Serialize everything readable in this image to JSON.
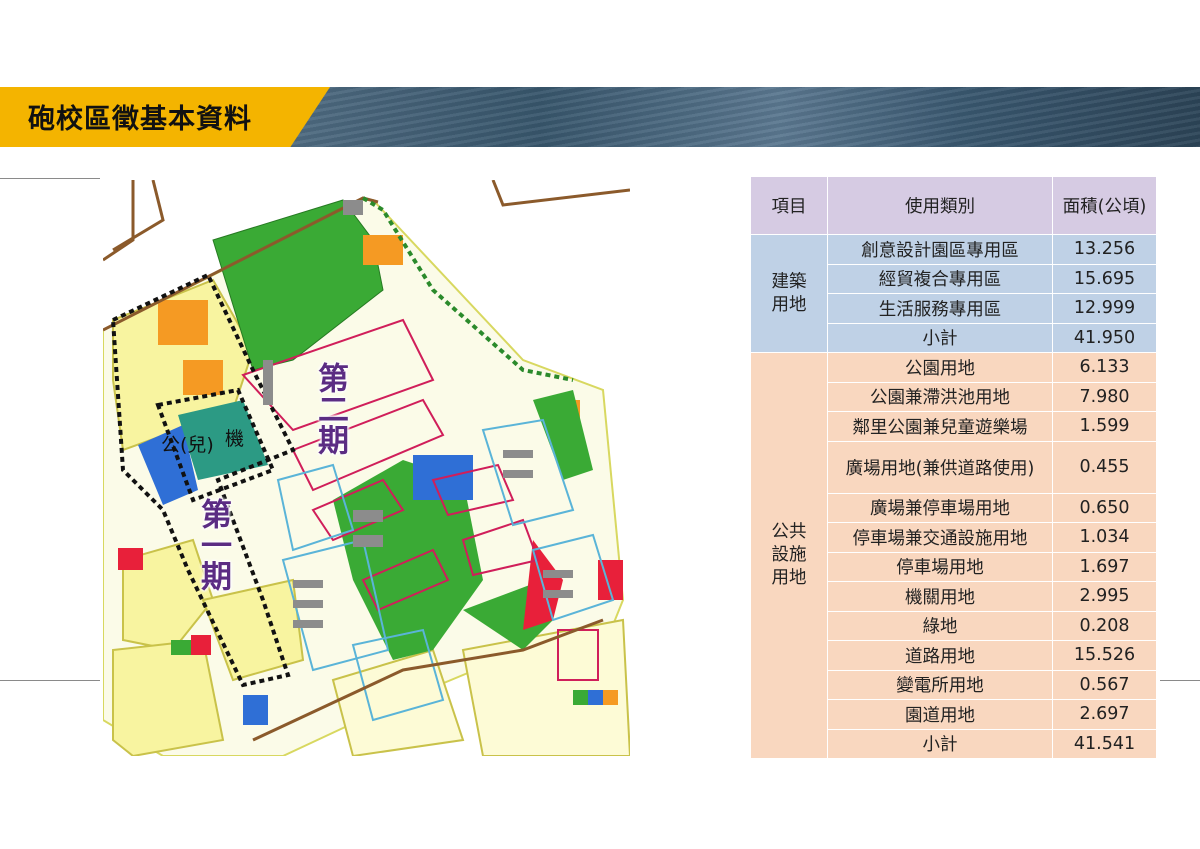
{
  "header": {
    "title": "砲校區徵基本資料"
  },
  "map": {
    "phase1_label": "第一期",
    "phase2_label": "第二期",
    "park_label": "公(兒)",
    "agency_label": "機"
  },
  "table": {
    "headers": [
      "項目",
      "使用類別",
      "面積(公頃)"
    ],
    "groups": [
      {
        "category": "建築用地",
        "rows": [
          {
            "type": "創意設計園區專用區",
            "area": "13.256"
          },
          {
            "type": "經貿複合專用區",
            "area": "15.695"
          },
          {
            "type": "生活服務專用區",
            "area": "12.999"
          },
          {
            "type": "小計",
            "area": "41.950"
          }
        ]
      },
      {
        "category": "公共設施用地",
        "rows": [
          {
            "type": "公園用地",
            "area": "6.133"
          },
          {
            "type": "公園兼滯洪池用地",
            "area": "7.980"
          },
          {
            "type": "鄰里公園兼兒童遊樂場",
            "area": "1.599"
          },
          {
            "type": "廣場用地(兼供道路使用)",
            "area": "0.455"
          },
          {
            "type": "廣場兼停車場用地",
            "area": "0.650"
          },
          {
            "type": "停車場兼交通設施用地",
            "area": "1.034"
          },
          {
            "type": "停車場用地",
            "area": "1.697"
          },
          {
            "type": "機關用地",
            "area": "2.995"
          },
          {
            "type": "綠地",
            "area": "0.208"
          },
          {
            "type": "道路用地",
            "area": "15.526"
          },
          {
            "type": "變電所用地",
            "area": "0.567"
          },
          {
            "type": "園道用地",
            "area": "2.697"
          },
          {
            "type": "小計",
            "area": "41.541"
          }
        ]
      }
    ]
  },
  "colors": {
    "banner_accent": "#f4b400",
    "header_row": "#d6cbe3",
    "building_land": "#bfd1e6",
    "public_land": "#f9d7bf",
    "phase_label": "#5b2c83"
  }
}
